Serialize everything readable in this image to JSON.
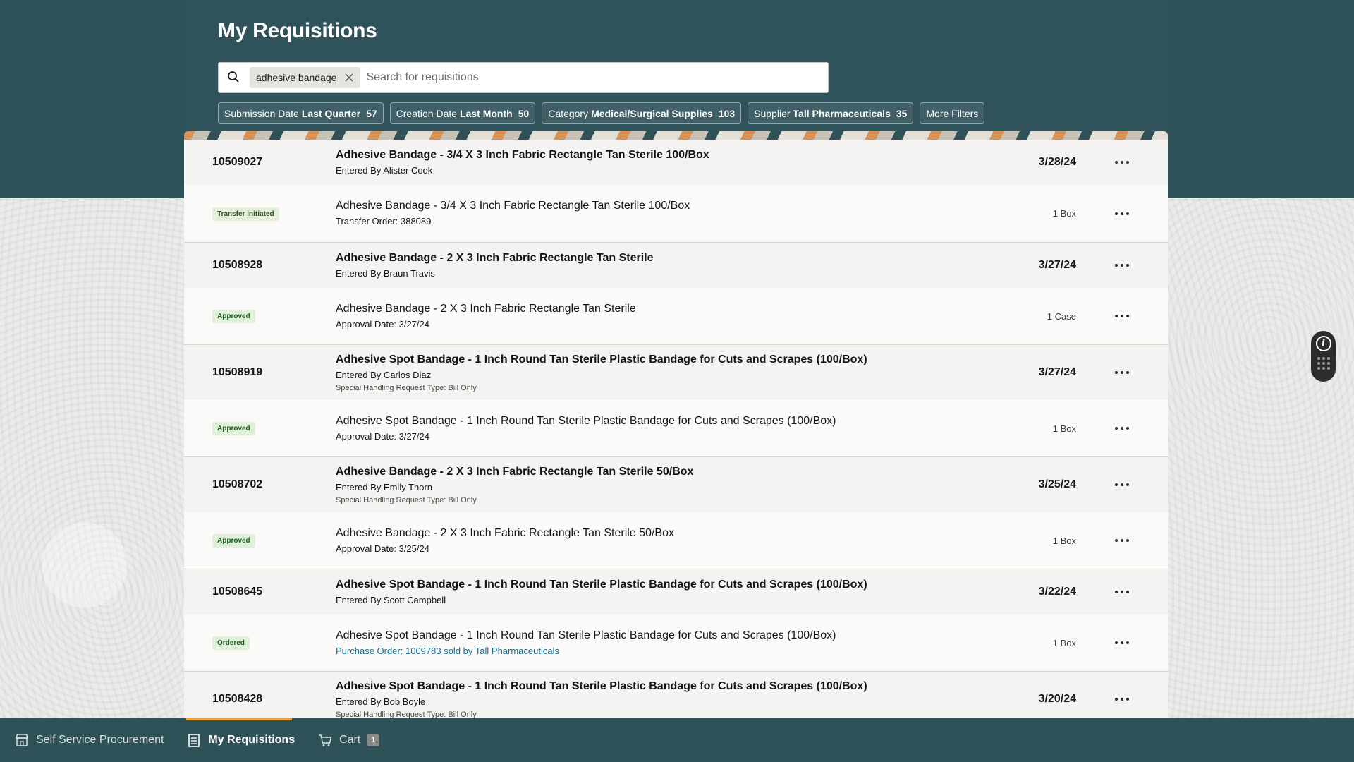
{
  "header": {
    "title": "My Requisitions"
  },
  "search": {
    "chip": "adhesive bandage",
    "placeholder": "Search for requisitions",
    "value": ""
  },
  "filters": [
    {
      "label": "Submission Date",
      "value": "Last Quarter",
      "count": "57"
    },
    {
      "label": "Creation Date",
      "value": "Last Month",
      "count": "50"
    },
    {
      "label": "Category",
      "value": "Medical/Surgical Supplies",
      "count": "103"
    },
    {
      "label": "Supplier",
      "value": "Tall Pharmaceuticals",
      "count": "35"
    },
    {
      "label": "More Filters",
      "value": "",
      "count": ""
    }
  ],
  "requisitions": [
    {
      "id": "10509027",
      "title": "Adhesive Bandage - 3/4 X 3 Inch Fabric Rectangle Tan Sterile 100/Box",
      "entered_by": "Entered By Alister Cook",
      "note": "",
      "date": "3/28/24",
      "line": {
        "status": "Transfer initiated",
        "title": "Adhesive Bandage - 3/4 X 3 Inch Fabric Rectangle Tan Sterile 100/Box",
        "meta": "Transfer Order: 388089",
        "qty": "1 Box"
      }
    },
    {
      "id": "10508928",
      "title": "Adhesive Bandage - 2 X 3 Inch Fabric Rectangle Tan Sterile",
      "entered_by": "Entered By Braun Travis",
      "note": "",
      "date": "3/27/24",
      "line": {
        "status": "Approved",
        "title": "Adhesive Bandage - 2 X 3 Inch Fabric Rectangle Tan Sterile",
        "meta": "Approval Date: 3/27/24",
        "qty": "1 Case"
      }
    },
    {
      "id": "10508919",
      "title": "Adhesive Spot Bandage - 1 Inch Round Tan Sterile Plastic Bandage for Cuts and Scrapes (100/Box)",
      "entered_by": "Entered By Carlos Diaz",
      "note": "Special Handling Request Type: Bill Only",
      "date": "3/27/24",
      "line": {
        "status": "Approved",
        "title": "Adhesive Spot Bandage - 1 Inch Round Tan Sterile Plastic Bandage for Cuts and Scrapes (100/Box)",
        "meta": "Approval Date: 3/27/24",
        "qty": "1 Box"
      }
    },
    {
      "id": "10508702",
      "title": "Adhesive Bandage - 2 X 3 Inch Fabric Rectangle Tan Sterile 50/Box",
      "entered_by": "Entered By Emily Thorn",
      "note": "Special Handling Request Type: Bill Only",
      "date": "3/25/24",
      "line": {
        "status": "Approved",
        "title": "Adhesive Bandage - 2 X 3 Inch Fabric Rectangle Tan Sterile 50/Box",
        "meta": "Approval Date: 3/25/24",
        "qty": "1 Box"
      }
    },
    {
      "id": "10508645",
      "title": "Adhesive Spot Bandage - 1 Inch Round Tan Sterile Plastic Bandage for Cuts and Scrapes (100/Box)",
      "entered_by": "Entered By Scott Campbell",
      "note": "",
      "date": "3/22/24",
      "line": {
        "status": "Ordered",
        "title": "Adhesive Spot Bandage - 1 Inch Round Tan Sterile Plastic Bandage for Cuts and Scrapes (100/Box)",
        "meta": "Purchase Order: 1009783 sold by Tall Pharmaceuticals",
        "qty": "1 Box"
      }
    },
    {
      "id": "10508428",
      "title": "Adhesive Spot Bandage - 1 Inch Round Tan Sterile Plastic Bandage for Cuts and Scrapes (100/Box)",
      "entered_by": "Entered By Bob Boyle",
      "note": "Special Handling Request Type: Bill Only",
      "date": "3/20/24"
    }
  ],
  "footer": {
    "nav": [
      {
        "label": "Self Service Procurement",
        "icon": "store-icon"
      },
      {
        "label": "My Requisitions",
        "icon": "clipboard-icon"
      },
      {
        "label": "Cart",
        "icon": "cart-icon",
        "badge": "1"
      }
    ]
  },
  "colors": {
    "header_bg": "#30525a",
    "accent": "#f0a43a",
    "link": "#1a6c8c"
  }
}
